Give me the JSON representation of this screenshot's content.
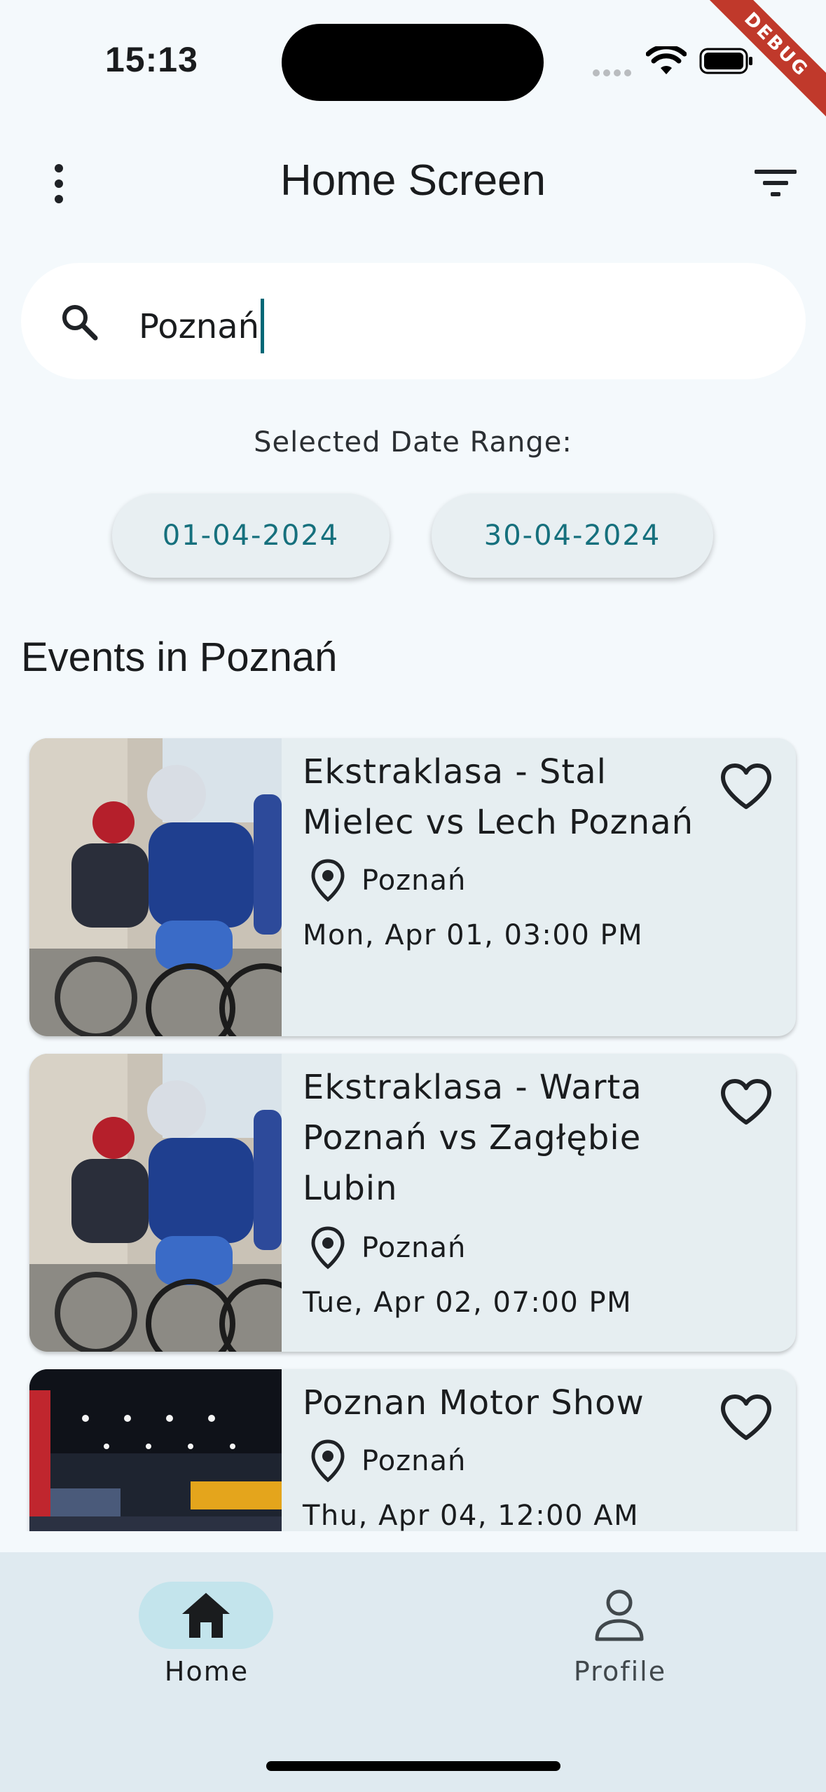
{
  "status": {
    "time": "15:13",
    "debug_label": "DEBUG"
  },
  "appbar": {
    "title": "Home Screen",
    "menu_icon": "more-vert-icon",
    "filter_icon": "filter-icon"
  },
  "search": {
    "value": "Poznań",
    "placeholder": ""
  },
  "date_range": {
    "label": "Selected Date Range:",
    "start": "01-04-2024",
    "end": "30-04-2024"
  },
  "events_heading": "Events in Poznań",
  "events": [
    {
      "title": "Ekstraklasa - Stal Mielec vs Lech Poznań",
      "location": "Poznań",
      "datetime": "Mon, Apr 01, 03:00 PM",
      "image": "cycling-race",
      "favorite": false
    },
    {
      "title": "Ekstraklasa - Warta Poznań vs Zagłębie Lubin",
      "location": "Poznań",
      "datetime": "Tue, Apr 02, 07:00 PM",
      "image": "cycling-race",
      "favorite": false
    },
    {
      "title": "Poznan Motor Show",
      "location": "Poznań",
      "datetime": "Thu, Apr 04, 12:00 AM",
      "image": "exhibition-hall",
      "favorite": false
    }
  ],
  "bottom_nav": [
    {
      "label": "Home",
      "icon": "home-icon",
      "selected": true
    },
    {
      "label": "Profile",
      "icon": "person-icon",
      "selected": false
    }
  ],
  "colors": {
    "accent": "#16707d",
    "background": "#f4f9fc",
    "card": "#e6eef1",
    "nav_selected": "#c3e4ec",
    "debug": "#c0392b"
  }
}
